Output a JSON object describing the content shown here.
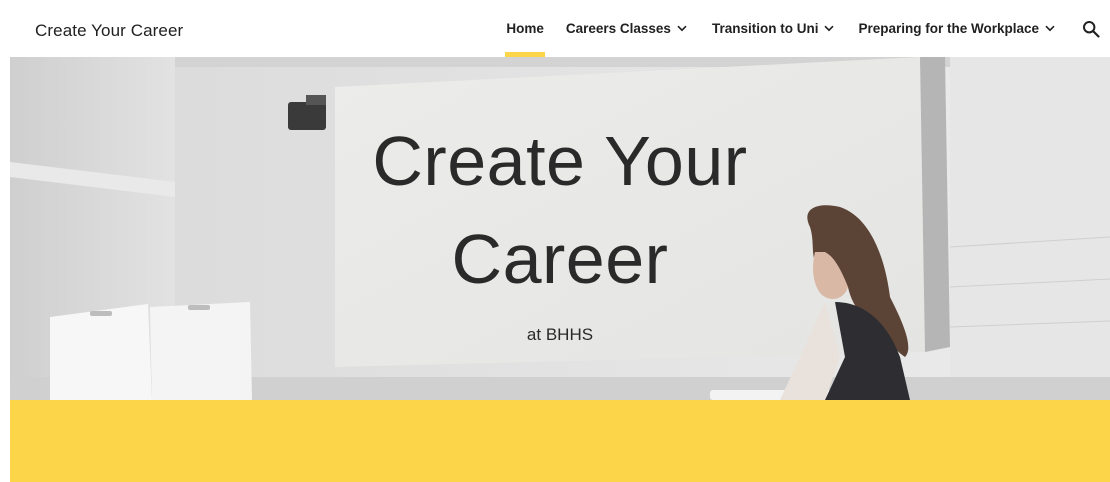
{
  "site": {
    "title": "Create Your Career"
  },
  "nav": {
    "items": [
      {
        "label": "Home",
        "active": true,
        "has_dropdown": false
      },
      {
        "label": "Careers Classes",
        "active": false,
        "has_dropdown": true
      },
      {
        "label": "Transition to Uni",
        "active": false,
        "has_dropdown": true
      },
      {
        "label": "Preparing for the Workplace",
        "active": false,
        "has_dropdown": true
      }
    ],
    "search_icon": "search-icon",
    "dropdown_icon": "chevron-down-icon"
  },
  "hero": {
    "title_line1": "Create Your",
    "title_line2": "Career",
    "subtitle": "at BHHS"
  },
  "colors": {
    "accent": "#fdd549",
    "text": "#212121",
    "background": "#ffffff"
  }
}
